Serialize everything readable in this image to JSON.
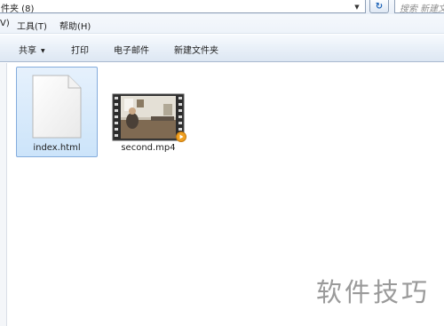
{
  "address_bar": {
    "path_text": "件夹 (8)",
    "search_placeholder": "搜索 新建文"
  },
  "menu": {
    "items": [
      "V)",
      "工具(T)",
      "帮助(H)"
    ]
  },
  "toolbar": {
    "share_label": "共享",
    "print_label": "打印",
    "email_label": "电子邮件",
    "new_folder_label": "新建文件夹"
  },
  "files": [
    {
      "name": "index.html",
      "type": "document",
      "selected": true
    },
    {
      "name": "second.mp4",
      "type": "video",
      "selected": false
    }
  ],
  "watermark": {
    "text": "软件技巧"
  },
  "colors": {
    "selection_fill": "#cce4fa",
    "selection_border": "#84acdd",
    "toolbar_border": "#a9b9cf",
    "play_badge": "#f0a020"
  }
}
